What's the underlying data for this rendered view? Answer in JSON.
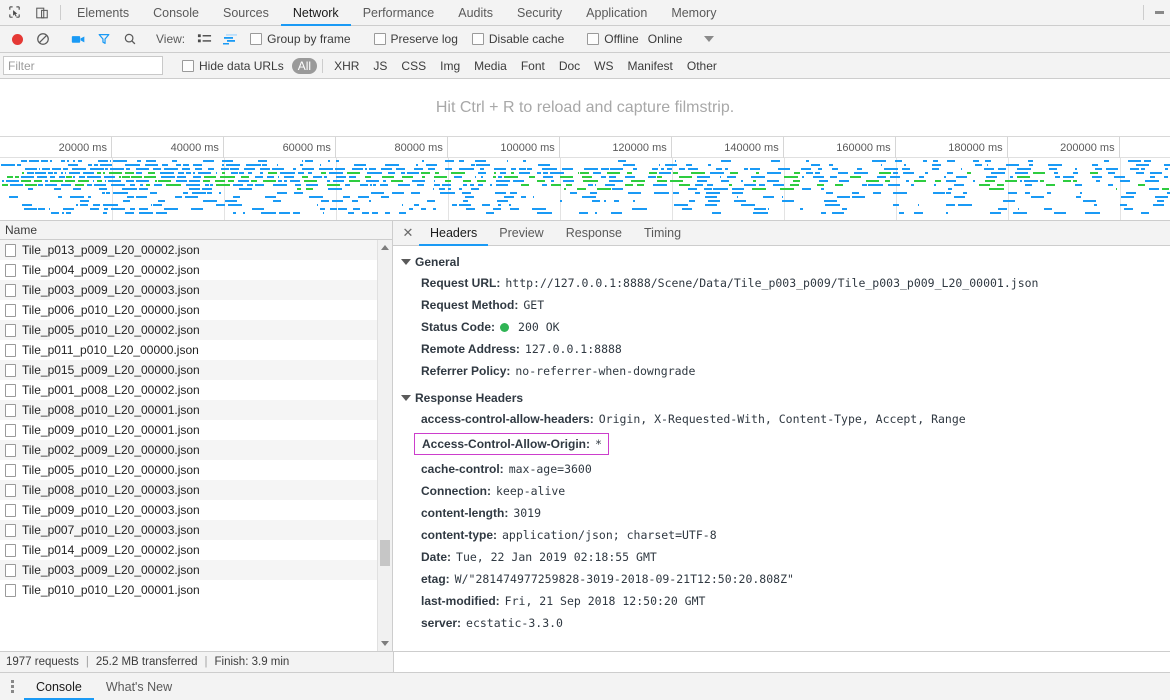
{
  "window": {
    "tabs": [
      {
        "label": "Elements",
        "active": false
      },
      {
        "label": "Console",
        "active": false
      },
      {
        "label": "Sources",
        "active": false
      },
      {
        "label": "Network",
        "active": true
      },
      {
        "label": "Performance",
        "active": false
      },
      {
        "label": "Audits",
        "active": false
      },
      {
        "label": "Security",
        "active": false
      },
      {
        "label": "Application",
        "active": false
      },
      {
        "label": "Memory",
        "active": false
      }
    ],
    "inspect_icon": "inspect-element-icon",
    "device_icon": "device-toolbar-icon",
    "more_icon": "more-options-icon"
  },
  "network_toolbar": {
    "record_icon": "record-button-icon",
    "clear_icon": "clear-button-icon",
    "filmstrip_icon": "camera-filmstrip-icon",
    "filter_icon": "filter-funnel-icon",
    "search_icon": "search-icon",
    "view_label": "View:",
    "list_view_icon": "list-view-icon",
    "waterfall_view_icon": "waterfall-view-icon",
    "group_by_frame": {
      "label": "Group by frame",
      "checked": false
    },
    "preserve_log": {
      "label": "Preserve log",
      "checked": false
    },
    "disable_cache": {
      "label": "Disable cache",
      "checked": false
    },
    "offline": {
      "label": "Offline",
      "checked": false
    },
    "throttling_value": "Online",
    "throttling_caret": "chevron-down-icon"
  },
  "filter_bar": {
    "input_value": "",
    "input_placeholder": "Filter",
    "hide_data_urls": {
      "label": "Hide data URLs",
      "checked": false
    },
    "types": [
      {
        "label": "All",
        "active": true
      },
      {
        "label": "XHR",
        "active": false
      },
      {
        "label": "JS",
        "active": false
      },
      {
        "label": "CSS",
        "active": false
      },
      {
        "label": "Img",
        "active": false
      },
      {
        "label": "Media",
        "active": false
      },
      {
        "label": "Font",
        "active": false
      },
      {
        "label": "Doc",
        "active": false
      },
      {
        "label": "WS",
        "active": false
      },
      {
        "label": "Manifest",
        "active": false
      },
      {
        "label": "Other",
        "active": false
      }
    ]
  },
  "filmstrip": {
    "message": "Hit Ctrl + R to reload and capture filmstrip."
  },
  "overview": {
    "ticks": [
      "20000 ms",
      "40000 ms",
      "60000 ms",
      "80000 ms",
      "100000 ms",
      "120000 ms",
      "140000 ms",
      "160000 ms",
      "180000 ms",
      "200000 ms"
    ],
    "bar_color_primary": "#1a9af5",
    "bar_color_secondary": "#2ecc40"
  },
  "request_list": {
    "column_header": "Name",
    "rows": [
      {
        "name": "Tile_p013_p009_L20_00002.json"
      },
      {
        "name": "Tile_p004_p009_L20_00002.json"
      },
      {
        "name": "Tile_p003_p009_L20_00003.json"
      },
      {
        "name": "Tile_p006_p010_L20_00000.json"
      },
      {
        "name": "Tile_p005_p010_L20_00002.json"
      },
      {
        "name": "Tile_p011_p010_L20_00000.json"
      },
      {
        "name": "Tile_p015_p009_L20_00000.json"
      },
      {
        "name": "Tile_p001_p008_L20_00002.json"
      },
      {
        "name": "Tile_p008_p010_L20_00001.json"
      },
      {
        "name": "Tile_p009_p010_L20_00001.json"
      },
      {
        "name": "Tile_p002_p009_L20_00000.json"
      },
      {
        "name": "Tile_p005_p010_L20_00000.json"
      },
      {
        "name": "Tile_p008_p010_L20_00003.json"
      },
      {
        "name": "Tile_p009_p010_L20_00003.json"
      },
      {
        "name": "Tile_p007_p010_L20_00003.json"
      },
      {
        "name": "Tile_p014_p009_L20_00002.json"
      },
      {
        "name": "Tile_p003_p009_L20_00002.json"
      },
      {
        "name": "Tile_p010_p010_L20_00001.json"
      }
    ]
  },
  "details": {
    "close_icon": "close-icon",
    "tabs": [
      {
        "label": "Headers",
        "active": true
      },
      {
        "label": "Preview",
        "active": false
      },
      {
        "label": "Response",
        "active": false
      },
      {
        "label": "Timing",
        "active": false
      }
    ],
    "general": {
      "title": "General",
      "items": [
        {
          "key": "Request URL:",
          "value": "http://127.0.0.1:8888/Scene/Data/Tile_p003_p009/Tile_p003_p009_L20_00001.json"
        },
        {
          "key": "Request Method:",
          "value": "GET"
        },
        {
          "key": "Status Code:",
          "value": "200 OK",
          "has_status_dot": true,
          "status_dot_color": "#30b455"
        },
        {
          "key": "Remote Address:",
          "value": "127.0.0.1:8888"
        },
        {
          "key": "Referrer Policy:",
          "value": "no-referrer-when-downgrade"
        }
      ]
    },
    "response_headers": {
      "title": "Response Headers",
      "items": [
        {
          "key": "access-control-allow-headers:",
          "value": "Origin, X-Requested-With, Content-Type, Accept, Range"
        },
        {
          "key": "Access-Control-Allow-Origin:",
          "value": "*",
          "highlighted": true
        },
        {
          "key": "cache-control:",
          "value": "max-age=3600"
        },
        {
          "key": "Connection:",
          "value": "keep-alive"
        },
        {
          "key": "content-length:",
          "value": "3019"
        },
        {
          "key": "content-type:",
          "value": "application/json; charset=UTF-8"
        },
        {
          "key": "Date:",
          "value": "Tue, 22 Jan 2019 02:18:55 GMT"
        },
        {
          "key": "etag:",
          "value": "W/\"281474977259828-3019-2018-09-21T12:50:20.808Z\""
        },
        {
          "key": "last-modified:",
          "value": "Fri, 21 Sep 2018 12:50:20 GMT"
        },
        {
          "key": "server:",
          "value": "ecstatic-3.3.0"
        }
      ]
    },
    "highlight_color": "#cc3ecc"
  },
  "status_bar": {
    "requests": "1977 requests",
    "transferred": "25.2 MB transferred",
    "finish": "Finish: 3.9 min",
    "separator": "|"
  },
  "drawer": {
    "more_icon": "drawer-more-icon",
    "tabs": [
      {
        "label": "Console",
        "active": true
      },
      {
        "label": "What's New",
        "active": false
      }
    ]
  },
  "colors": {
    "accent": "#1a9af5",
    "toolbar_bg": "#f3f3f3",
    "border": "#cdcdcd"
  }
}
